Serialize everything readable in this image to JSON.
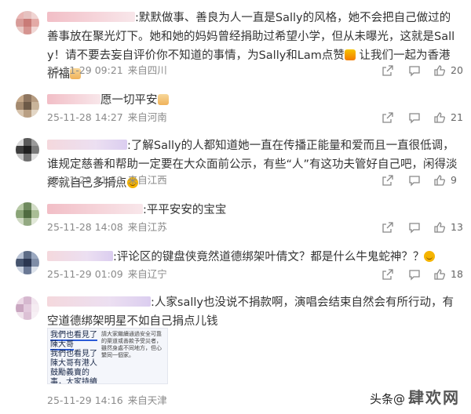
{
  "comments": [
    {
      "text": ":默默做事、善良为人一直是Sally的风格，她不会把自己做过的善事放在聚光灯下。她和她的妈妈曾经捐助过希望小学，但从未曝光，这就是Sally！请不要去妄自评价你不知道的事情，为Sally和Lam点赞",
      "tail": " 让我们一起为香港祈福",
      "date": "25-11-29 09:21",
      "location": "来自四川",
      "likes": "20"
    },
    {
      "text": "愿一切平安",
      "date": "25-11-28 14:27",
      "location": "来自河南",
      "likes": "21"
    },
    {
      "text": ":了解Sally的人都知道她一直在传播正能量和爱而且一直很低调，谁规定慈善和帮助一定要在大众面前公示，有些“人”有这功夫管好自己吧，闲得淡疼就自己多捐点",
      "date": "25-11-29 11:59",
      "location": "来自江西",
      "likes": "9"
    },
    {
      "text": ":平平安安的宝宝",
      "date": "25-11-28 14:08",
      "location": "来自江苏",
      "likes": "13"
    },
    {
      "text": ":评论区的键盘侠竟然道德绑架叶倩文？都是什么牛鬼蛇神？？",
      "date": "25-11-29 01:09",
      "location": "来自辽宁",
      "likes": "18"
    },
    {
      "text": ":人家sally也没说不捐款啊，演唱会结束自然会有所行动，有空道德绑架明星不如自己捐点儿钱",
      "date": "25-11-29 14:16",
      "location": "来自天津",
      "likes": "",
      "image_text_left": "我們也看見了陳大哥有港人鼓勵義賣的事，大家持續溫通了我送上愛與支持",
      "image_text_highlight": "我們也看見了陳大哥",
      "image_text_right": "請大家繼續通過安全可靠的渠道或善款予受災者，雖然身處不同地方，但心繫同一個家。"
    }
  ],
  "watermark": {
    "prefix": "头条",
    "suffix": "@",
    "big": "肆欢网"
  },
  "colors": {
    "meta_gray": "#8a8a8a",
    "icon_gray": "#888888"
  }
}
